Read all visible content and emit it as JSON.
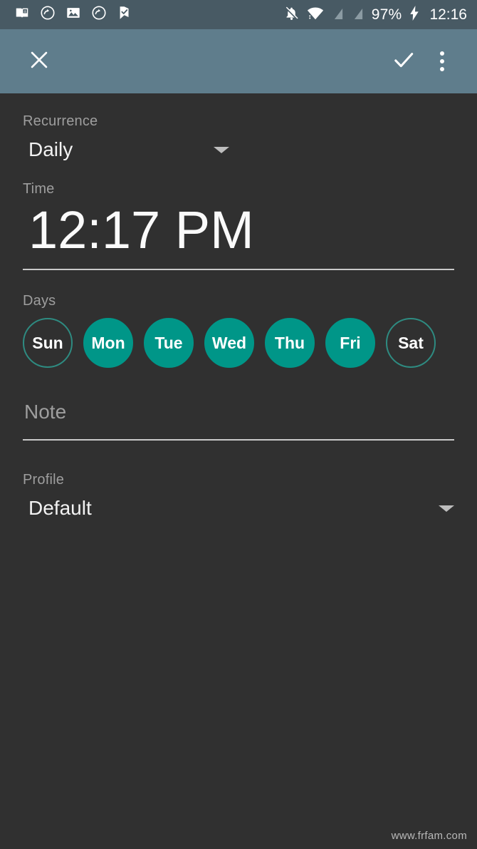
{
  "status_bar": {
    "background": "#485a64",
    "notification_icons": [
      {
        "name": "book-reader-icon"
      },
      {
        "name": "sync-rotate-icon"
      },
      {
        "name": "image-icon"
      },
      {
        "name": "sync-rotate-icon-2"
      },
      {
        "name": "check-flag-icon"
      }
    ],
    "bell_muted_icon": "bell-off-icon",
    "wifi_icon": "wifi-icon",
    "signal_icons": [
      "signal-off-icon-1",
      "signal-off-icon-2"
    ],
    "battery_percent": "97%",
    "charging_icon": "charging-bolt-icon",
    "clock": "12:16"
  },
  "toolbar": {
    "background": "#5f7d8c",
    "close_icon": "close-icon",
    "confirm_icon": "check-icon",
    "overflow_icon": "more-vertical-icon"
  },
  "form": {
    "recurrence": {
      "label": "Recurrence",
      "value": "Daily",
      "caret_icon": "chevron-down-icon"
    },
    "time": {
      "label": "Time",
      "value": "12:17 PM"
    },
    "days": {
      "label": "Days",
      "selected_color": "#009688",
      "items": [
        {
          "label": "Sun",
          "selected": false
        },
        {
          "label": "Mon",
          "selected": true
        },
        {
          "label": "Tue",
          "selected": true
        },
        {
          "label": "Wed",
          "selected": true
        },
        {
          "label": "Thu",
          "selected": true
        },
        {
          "label": "Fri",
          "selected": true
        },
        {
          "label": "Sat",
          "selected": false
        }
      ]
    },
    "note": {
      "placeholder": "Note",
      "value": ""
    },
    "profile": {
      "label": "Profile",
      "value": "Default",
      "caret_icon": "chevron-down-icon"
    }
  },
  "watermark": "www.frfam.com"
}
